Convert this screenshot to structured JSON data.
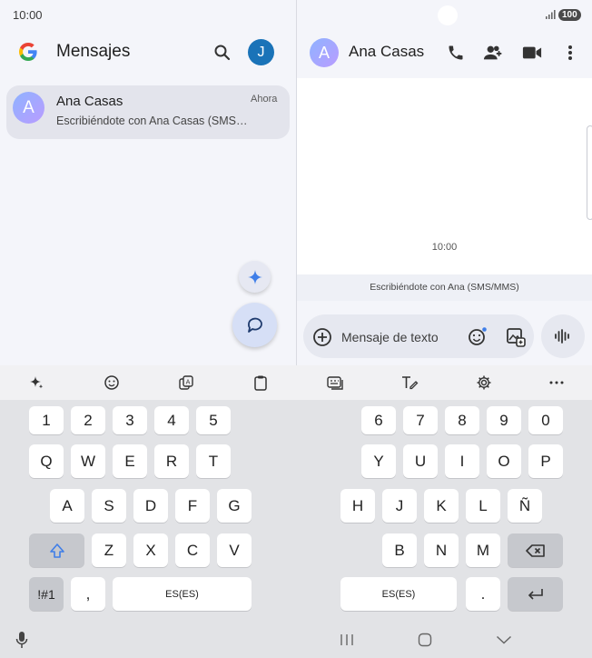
{
  "status_bar": {
    "time": "10:00",
    "battery": "100",
    "signal_icon": "signal-bars-icon"
  },
  "conversation_list": {
    "title": "Mensajes",
    "account_initial": "J",
    "items": [
      {
        "avatar_initial": "A",
        "name": "Ana Casas",
        "time": "Ahora",
        "preview": "Escribiéndote con Ana Casas (SMS…"
      }
    ]
  },
  "thread": {
    "contact_initial": "A",
    "contact_name": "Ana Casas",
    "timestamp": "10:00",
    "sms_notice": "Escribiéndote con Ana (SMS/MMS)",
    "composer_placeholder": "Mensaje de texto"
  },
  "keyboard": {
    "toolbar_icons": [
      "sparkle-icon",
      "emoji-icon",
      "translate-icon",
      "clipboard-icon",
      "keyboard-layout-icon",
      "handwriting-icon",
      "settings-icon",
      "more-icon"
    ],
    "left": {
      "row_numbers": [
        "1",
        "2",
        "3",
        "4",
        "5"
      ],
      "row1": [
        "Q",
        "W",
        "E",
        "R",
        "T"
      ],
      "row2": [
        "A",
        "S",
        "D",
        "F",
        "G"
      ],
      "row3": [
        "Z",
        "X",
        "C",
        "V"
      ],
      "symbols_key": "!#1",
      "comma_key": ",",
      "space_label": "ES(ES)"
    },
    "right": {
      "row_numbers": [
        "6",
        "7",
        "8",
        "9",
        "0"
      ],
      "row1": [
        "Y",
        "U",
        "I",
        "O",
        "P"
      ],
      "row2": [
        "H",
        "J",
        "K",
        "L",
        "Ñ"
      ],
      "row3": [
        "B",
        "N",
        "M"
      ],
      "space_label": "ES(ES)",
      "period_key": "."
    }
  },
  "colors": {
    "accent": "#1a73b8",
    "fab": "#d6dff6",
    "selected_row": "#e3e4ec"
  }
}
